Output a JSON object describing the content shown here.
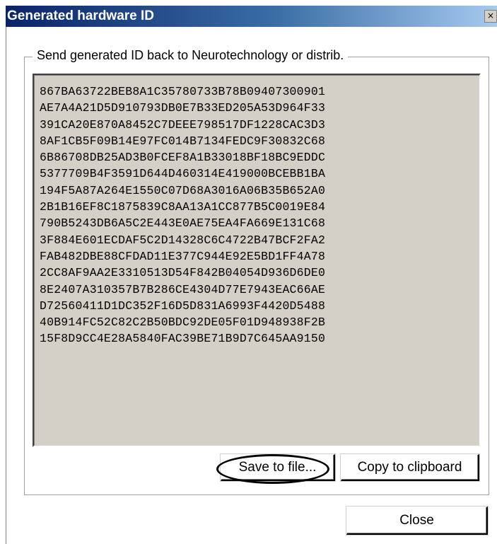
{
  "window": {
    "title": "Generated hardware ID",
    "close_glyph": "×"
  },
  "group": {
    "legend": "Send generated ID back to Neurotechnology or distrib."
  },
  "hardware_id": {
    "lines": [
      "867BA63722BEB8A1C35780733B78B09407300901",
      "AE7A4A21D5D910793DB0E7B33ED205A53D964F33",
      "391CA20E870A8452C7DEEE798517DF1228CAC3D3",
      "8AF1CB5F09B14E97FC014B7134FEDC9F30832C68",
      "6B86708DB25AD3B0FCEF8A1B33018BF18BC9EDDC",
      "5377709B4F3591D644D460314E419000BCEBB1BA",
      "194F5A87A264E1550C07D68A3016A06B35B652A0",
      "2B1B16EF8C1875839C8AA13A1CC877B5C0019E84",
      "790B5243DB6A5C2E443E0AE75EA4FA669E131C68",
      "3F884E601ECDAF5C2D14328C6C4722B47BCF2FA2",
      "FAB482DBE88CFDAD11E377C944E92E5BD1FF4A78",
      "2CC8AF9AA2E3310513D54F842B04054D936D6DE0",
      "8E2407A310357B7B286CE4304D77E7943EAC66AE",
      "D72560411D1DC352F16D5D831A6993F4420D5488",
      "40B914FC52C82C2B50BDC92DE05F01D948938F2B",
      "15F8D9CC4E28A5840FAC39BE71B9D7C645AA9150"
    ]
  },
  "buttons": {
    "save_label": "Save to file...",
    "copy_label": "Copy to clipboard",
    "close_label": "Close"
  }
}
